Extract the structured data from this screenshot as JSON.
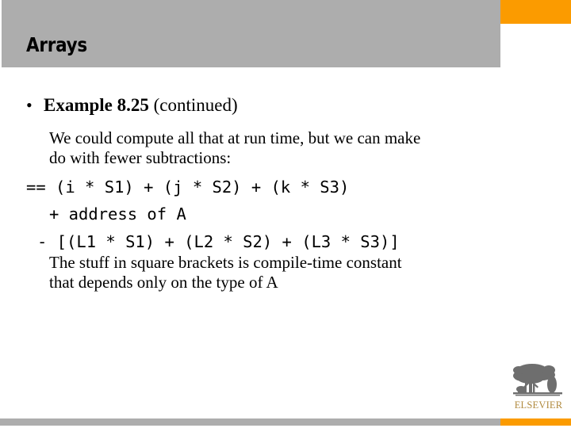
{
  "slide": {
    "title": "Arrays",
    "colors": {
      "header_gray": "#adadad",
      "accent_orange": "#fb9b00",
      "logo_gold": "#b08a3e",
      "text": "#000000"
    }
  },
  "bullet": {
    "marker": "•",
    "strong_text": "Example 8.25",
    "rest_text": " (continued)"
  },
  "body": {
    "paragraph_top": [
      "We could compute all that at run time, but we can make",
      "do with fewer subtractions:"
    ],
    "code_lines": [
      "== (i * S1) + (j * S2) + (k * S3)",
      "+ address of A",
      "- [(L1 * S1) + (L2 * S2) + (L3 * S3)]"
    ],
    "paragraph_bottom": [
      "The stuff in square brackets is compile-time constant",
      "that depends only on the type of A"
    ]
  },
  "footer": {
    "logo_wordmark": "ELSEVIER",
    "logo_icon": "elsevier-tree-icon"
  }
}
